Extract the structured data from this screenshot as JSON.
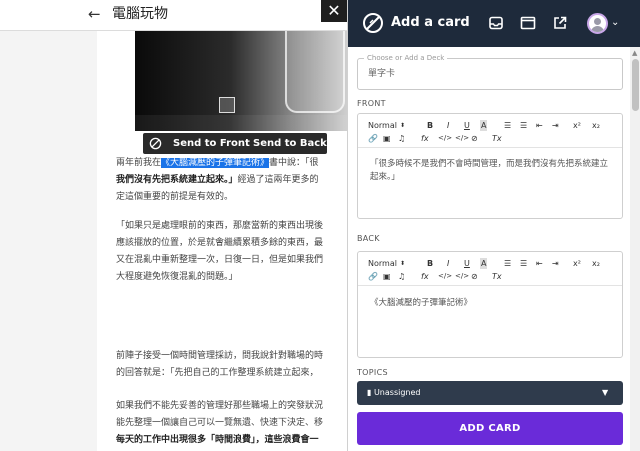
{
  "article": {
    "back_icon": "arrow-left-icon",
    "site_title": "電腦玩物",
    "close_symbol": "✕",
    "paragraphs": [
      {
        "lines": [
          [
            "兩年前我在",
            "《大腦減壓的子彈筆記術》",
            "書中說：「很"
          ],
          [
            "我們沒有先把系統建立起來。」",
            "經過了這兩年更多的"
          ],
          [
            "定這個重要的前提是有效的。"
          ]
        ]
      },
      {
        "lines": [
          [
            "「如果只是處理眼前的東西，那麼當新的東西出現後"
          ],
          [
            "應該擺放的位置，於是就會繼續累積多餘的東西，最"
          ],
          [
            "又在混亂中重新整理一次，日復一日，但是如果我們"
          ],
          [
            "大程度避免恢復混亂的問題。」"
          ]
        ]
      },
      {
        "lines": [
          [
            "前陣子接受一個時間管理採訪，問我說針對職場的時"
          ],
          [
            "的回答就是：「先把自己的工作整理系統建立起來，"
          ]
        ]
      },
      {
        "lines": [
          [
            "如果我們不能先妥善的管理好那些職場上的突發狀況"
          ],
          [
            "能先整理一個讓自己可以一覽無遺、快速下決定、移"
          ],
          [
            "每天的工作中出現很多「時間浪費」，這些浪費會一"
          ]
        ]
      }
    ],
    "image_toolbar": {
      "icon": "lens-slash-icon",
      "send_front": "Send to Front",
      "send_back": "Send to Back"
    }
  },
  "panel": {
    "title": "Add a card",
    "header_icons": [
      "inbox-icon",
      "window-icon",
      "external-link-icon",
      "user-avatar-icon",
      "chevron-down-icon"
    ],
    "deck": {
      "legend": "Choose or Add a Deck",
      "value": "單字卡"
    },
    "front": {
      "label": "FRONT",
      "toolbar": {
        "format": "Normal",
        "format_caret": "⬍",
        "bold": "B",
        "italic": "I",
        "underline": "U",
        "highlight": "A",
        "superscript": "x²",
        "subscript": "x₂",
        "formula": "fx",
        "code": "</>",
        "clear": "Tx"
      },
      "content": "「很多時候不是我們不會時間管理，而是我們沒有先把系統建立起來。」"
    },
    "back": {
      "label": "BACK",
      "content": "《大腦減壓的子彈筆記術》"
    },
    "topics": {
      "label": "TOPICS",
      "value": "Unassigned",
      "caret": "▼"
    },
    "add_button": "ADD CARD"
  }
}
